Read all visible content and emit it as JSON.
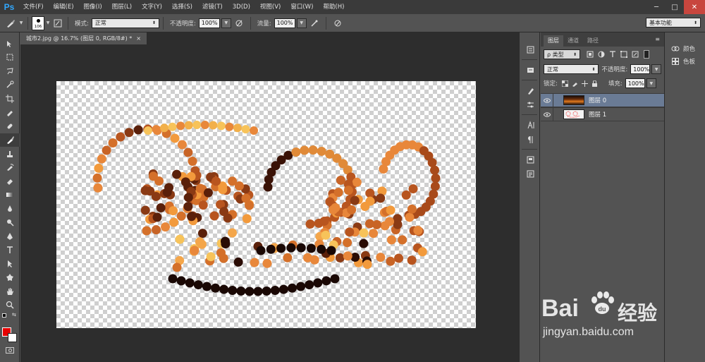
{
  "app": {
    "logo": "Ps"
  },
  "menu": [
    "文件(F)",
    "编辑(E)",
    "图像(I)",
    "图层(L)",
    "文字(Y)",
    "选择(S)",
    "滤镜(T)",
    "3D(D)",
    "视图(V)",
    "窗口(W)",
    "帮助(H)"
  ],
  "window_controls": {
    "minimize": "─",
    "maximize": "□",
    "close": "✕"
  },
  "options": {
    "brush_size": "106",
    "mode_label": "模式:",
    "mode_value": "正常",
    "opacity_label": "不透明度:",
    "opacity_value": "100%",
    "flow_label": "流量:",
    "flow_value": "100%",
    "workspace": "基本功能"
  },
  "document": {
    "tab_title": "城市2.jpg @ 16.7% (图层 0, RGB/8#) *",
    "close": "×"
  },
  "colors": {
    "foreground": "#e60000",
    "background": "#ffffff",
    "accent": "#31a8ff"
  },
  "layers_panel": {
    "tabs": [
      "图层",
      "通道",
      "路径"
    ],
    "menu": "≡",
    "filter_kind": "ρ 类型",
    "blend_mode": "正常",
    "opacity_label": "不透明度:",
    "opacity_value": "100%",
    "lock_label": "锁定:",
    "fill_label": "填充:",
    "fill_value": "100%",
    "layers": [
      {
        "name": "图层 0",
        "selected": true,
        "visible": true
      },
      {
        "name": "图层 1",
        "selected": false,
        "visible": true
      }
    ]
  },
  "right_panel": {
    "items": [
      {
        "label": "颜色",
        "icon": "palette-icon"
      },
      {
        "label": "色板",
        "icon": "swatches-icon"
      }
    ]
  },
  "watermark": {
    "brand": "Bai",
    "brand2": "经验",
    "url": "jingyan.baidu.com"
  }
}
